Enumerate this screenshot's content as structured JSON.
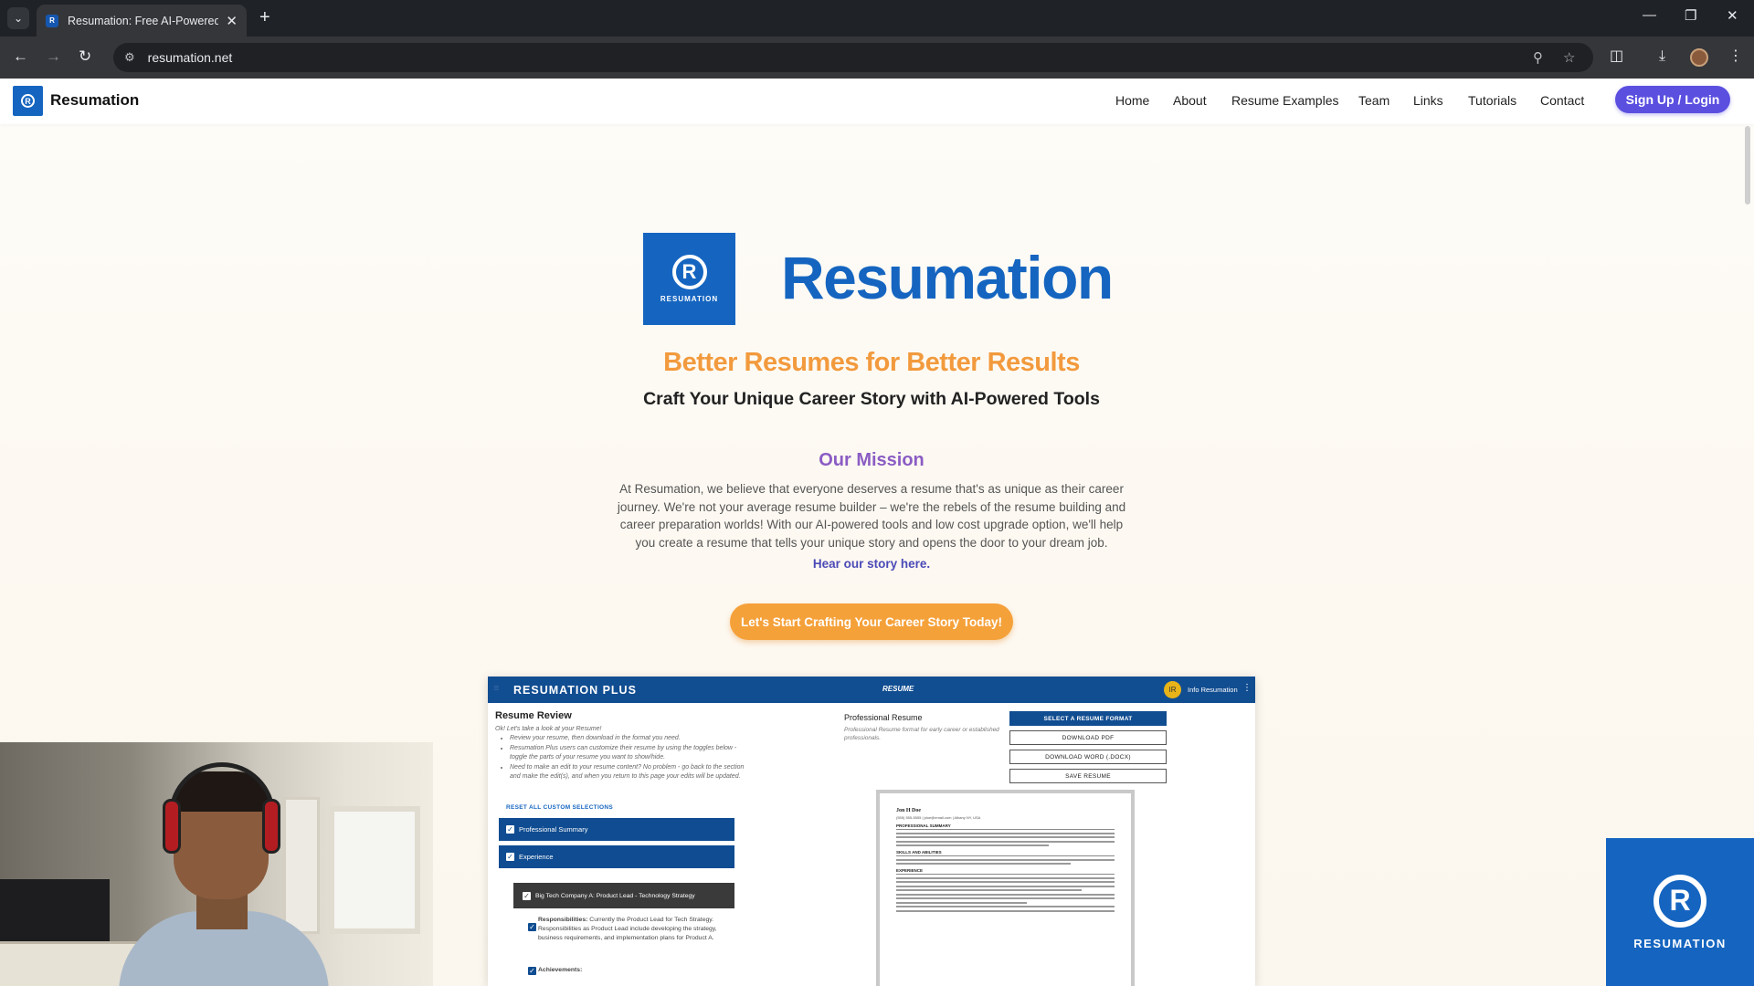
{
  "browser": {
    "tab_title": "Resumation: Free AI-Powered R",
    "tab_close": "✕",
    "new_tab": "+",
    "tab_list": "⌄",
    "url": "resumation.net",
    "favicon_letter": "R",
    "icons": [
      "back-icon",
      "forward-icon",
      "reload-icon",
      "site-settings-icon",
      "zoom-icon",
      "star-icon",
      "extensions-icon",
      "download-icon",
      "profile-icon",
      "menu-icon",
      "minimize-icon",
      "restore-icon",
      "close-icon"
    ]
  },
  "header": {
    "logo_letter": "R",
    "site_name": "Resumation",
    "nav": [
      "Home",
      "About",
      "Resume Examples",
      "Team",
      "Links",
      "Tutorials",
      "Contact"
    ],
    "signup": "Sign Up / Login"
  },
  "hero": {
    "logo_letter": "R",
    "logo_word": "RESUMATION",
    "title": "Resumation",
    "tagline": "Better Resumes for Better Results",
    "subtagline": "Craft Your Unique Career Story with AI-Powered Tools",
    "mission_title": "Our Mission",
    "mission_text": "At Resumation, we believe that everyone deserves a resume that's as unique as their career journey. We're not your average resume builder – we're the rebels of the resume building and career preparation worlds! With our AI-powered tools and low cost upgrade option, we'll help you create a resume that tells your unique story and opens the door to your dream job.",
    "story_link": "Hear our story here.",
    "cta": "Let's Start Crafting Your Career Story Today!"
  },
  "app_preview": {
    "menu_icon": "≡",
    "brand": "RESUMATION PLUS",
    "tab": "RESUME",
    "avatar_initials": "IR",
    "user": "Info Resumation",
    "kebab": "⋮",
    "review_title": "Resume Review",
    "intro": "Ok! Let's take a look at your Resume!",
    "bullets": [
      "Review your resume, then download in the format you need.",
      "Resumation Plus users can customize their resume by using the toggles below - toggle the parts of your resume you want to show/hide.",
      "Need to make an edit to your resume content? No problem - go back to the section and make the edit(s), and when you return to this page your edits will be updated."
    ],
    "reset": "RESET ALL CUSTOM SELECTIONS",
    "sections": [
      "Professional Summary",
      "Experience"
    ],
    "job": "Big Tech Company A: Product Lead - Technology Strategy",
    "responsibilities_label": "Responsibilities:",
    "responsibilities_text": "Currently the Product Lead for Tech Strategy. Responsibilities as Product Lead include developing the strategy, business requirements, and implementation plans for Product A.",
    "achievements_label": "Achievements:",
    "check": "✓",
    "pr_title": "Professional Resume",
    "pr_sub": "Professional Resume format for early career or established professionals.",
    "buttons": [
      "SELECT A RESUME FORMAT",
      "DOWNLOAD PDF",
      "DOWNLOAD WORD (.DOCX)",
      "SAVE RESUME"
    ],
    "doc_name": "Jon H Doe",
    "doc_contact": "(555) 555-5555 | jdoe@email.com | Albany NY, USA",
    "doc_sections": [
      "PROFESSIONAL SUMMARY",
      "SKILLS AND ABILITIES",
      "EXPERIENCE"
    ]
  },
  "badge": {
    "letter": "R",
    "word": "RESUMATION"
  }
}
